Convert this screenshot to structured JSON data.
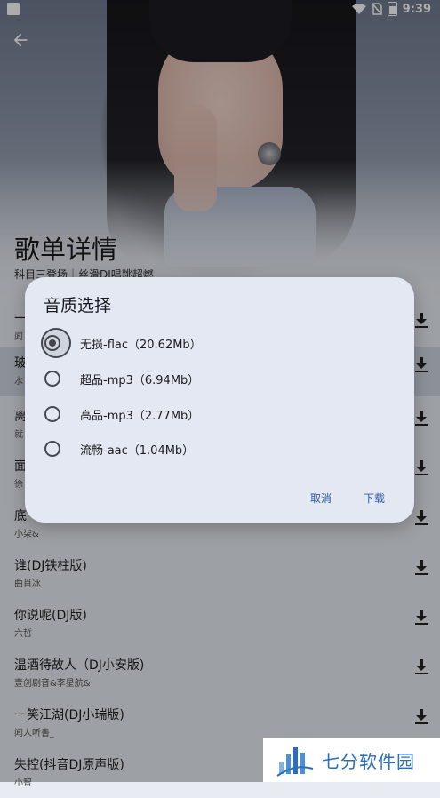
{
  "status_bar": {
    "time": "9:39"
  },
  "header": {
    "title": "歌单详情",
    "subtitle": "科目三登场｜丝滑DJ唱跳超燃"
  },
  "songs": [
    {
      "title": "一",
      "artist": "闻"
    },
    {
      "title": "玻",
      "artist": "水"
    },
    {
      "title": "离",
      "artist": "就"
    },
    {
      "title": "面",
      "artist": "徐"
    },
    {
      "title": "底",
      "artist": "小柒&"
    },
    {
      "title": "谁(DJ铁柱版)",
      "artist": "曲肖冰"
    },
    {
      "title": "你说呢(DJ版)",
      "artist": "六哲"
    },
    {
      "title": "温酒待故人（DJ小安版)",
      "artist": "壹创剧音&李星航&"
    },
    {
      "title": "一笑江湖(DJ小瑞版)",
      "artist": "闻人听書_"
    },
    {
      "title": "失控(抖音DJ原声版)",
      "artist": "小智"
    }
  ],
  "dialog": {
    "title": "音质选择",
    "options": [
      {
        "label": "无损-flac（20.62Mb）",
        "selected": true
      },
      {
        "label": "超品-mp3（6.94Mb）",
        "selected": false
      },
      {
        "label": "高品-mp3（2.77Mb）",
        "selected": false
      },
      {
        "label": "流畅-aac（1.04Mb）",
        "selected": false
      }
    ],
    "cancel_label": "取消",
    "download_label": "下载"
  },
  "watermark": {
    "text": "七分软件园"
  },
  "colors": {
    "accent": "#2f5ba7",
    "dialog_bg": "#e3e8f2",
    "highlight_row": "#cfd6e2"
  }
}
